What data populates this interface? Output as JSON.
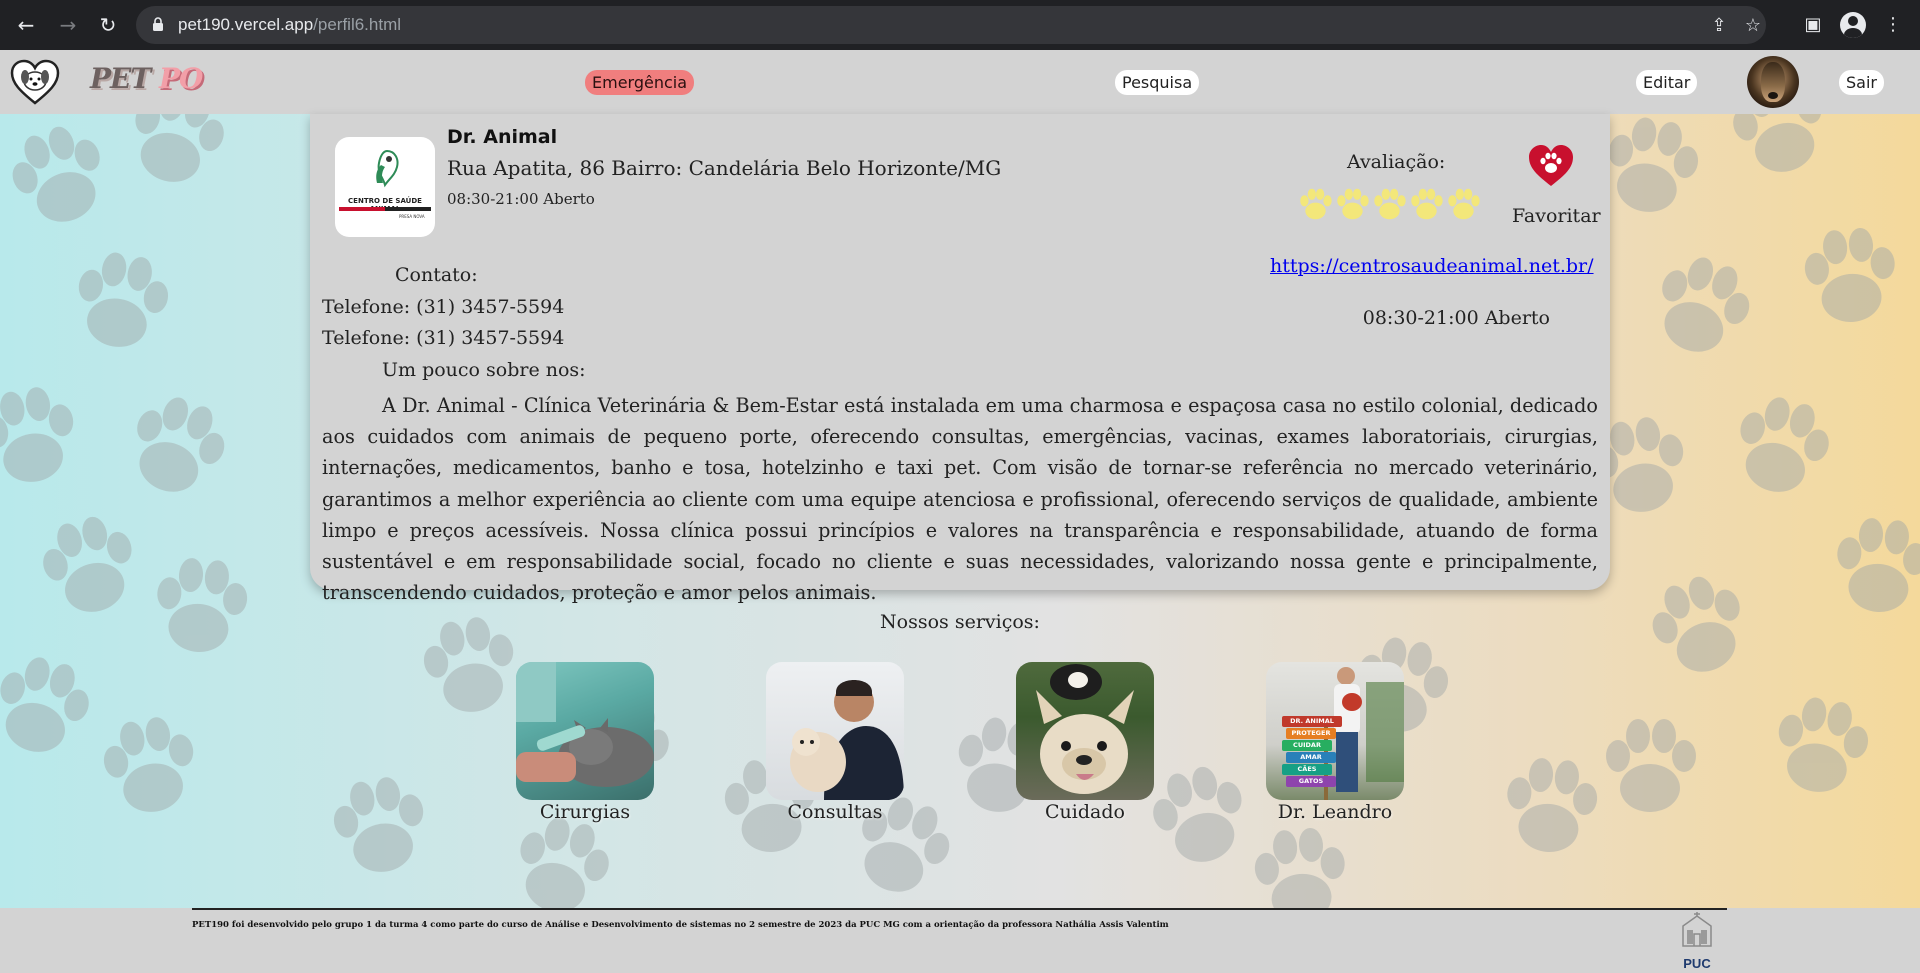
{
  "browser": {
    "url_host": "pet190.vercel.app",
    "url_path": "/perfil6.html"
  },
  "header": {
    "logo_pet": "PET",
    "logo_po": "PO",
    "emergency_label": "Emergência",
    "search_label": "Pesquisa",
    "edit_label": "Editar",
    "logout_label": "Sair"
  },
  "clinic": {
    "name": "Dr. Animal",
    "address": "Rua Apatita, 86 Bairro: Candelária Belo Horizonte/MG",
    "hours": "08:30-21:00 Aberto",
    "logo_text": "CENTRO DE SAÚDE ANIMAL",
    "logo_subtext": "PRESA NOVA",
    "rating_label": "Avaliação:",
    "rating": 5,
    "rating_max": 5,
    "favorite_label": "Favoritar",
    "website": "https://centrosaudeanimal.net.br/",
    "hours_side": "08:30-21:00 Aberto",
    "contact_title": "Contato:",
    "phone1": "Telefone: (31) 3457-5594",
    "phone2": "Telefone: (31) 3457-5594",
    "about_title": "Um pouco sobre nos:",
    "about_text": "A Dr. Animal - Clínica Veterinária & Bem-Estar está instalada em uma charmosa e espaçosa casa no estilo colonial, dedicado aos cuidados com animais de pequeno porte, oferecendo consultas, emergências, vacinas, exames laboratoriais, cirurgias, internações, medicamentos, banho e tosa, hotelzinho e taxi pet. Com visão de tornar-se referência no mercado veterinário, garantimos a melhor experiência ao cliente com uma equipe atenciosa e profissional, oferecendo serviços de qualidade, ambiente limpo e preços acessíveis. Nossa clínica possui princípios e valores na transparência e responsabilidade, atuando de forma sustentável e em responsabilidade social, focado no cliente e suas necessidades, valorizando nossa gente e principalmente, transcendendo cuidados, proteção e amor pelos animais."
  },
  "services": {
    "title": "Nossos serviços:",
    "items": [
      {
        "label": "Cirurgias"
      },
      {
        "label": "Consultas"
      },
      {
        "label": "Cuidado"
      },
      {
        "label": "Dr. Leandro"
      }
    ],
    "sign_words": [
      "DR. ANIMAL",
      "PROTEGER",
      "CUIDAR",
      "AMAR",
      "CÃES",
      "GATOS"
    ]
  },
  "footer": {
    "text": "PET190 foi desenvolvido pelo grupo 1 da turma 4 como parte do curso de Análise e Desenvolvimento de sistemas no 2 semestre de 2023 da PUC MG com a orientação da professora Nathália Assis Valentim",
    "university": "PUC Minas"
  },
  "colors": {
    "emergency": "#f07e7e",
    "header_bg": "#d3d3d3",
    "star": "#f3e77a",
    "favorite": "#c8102e",
    "link": "#0000ee"
  }
}
